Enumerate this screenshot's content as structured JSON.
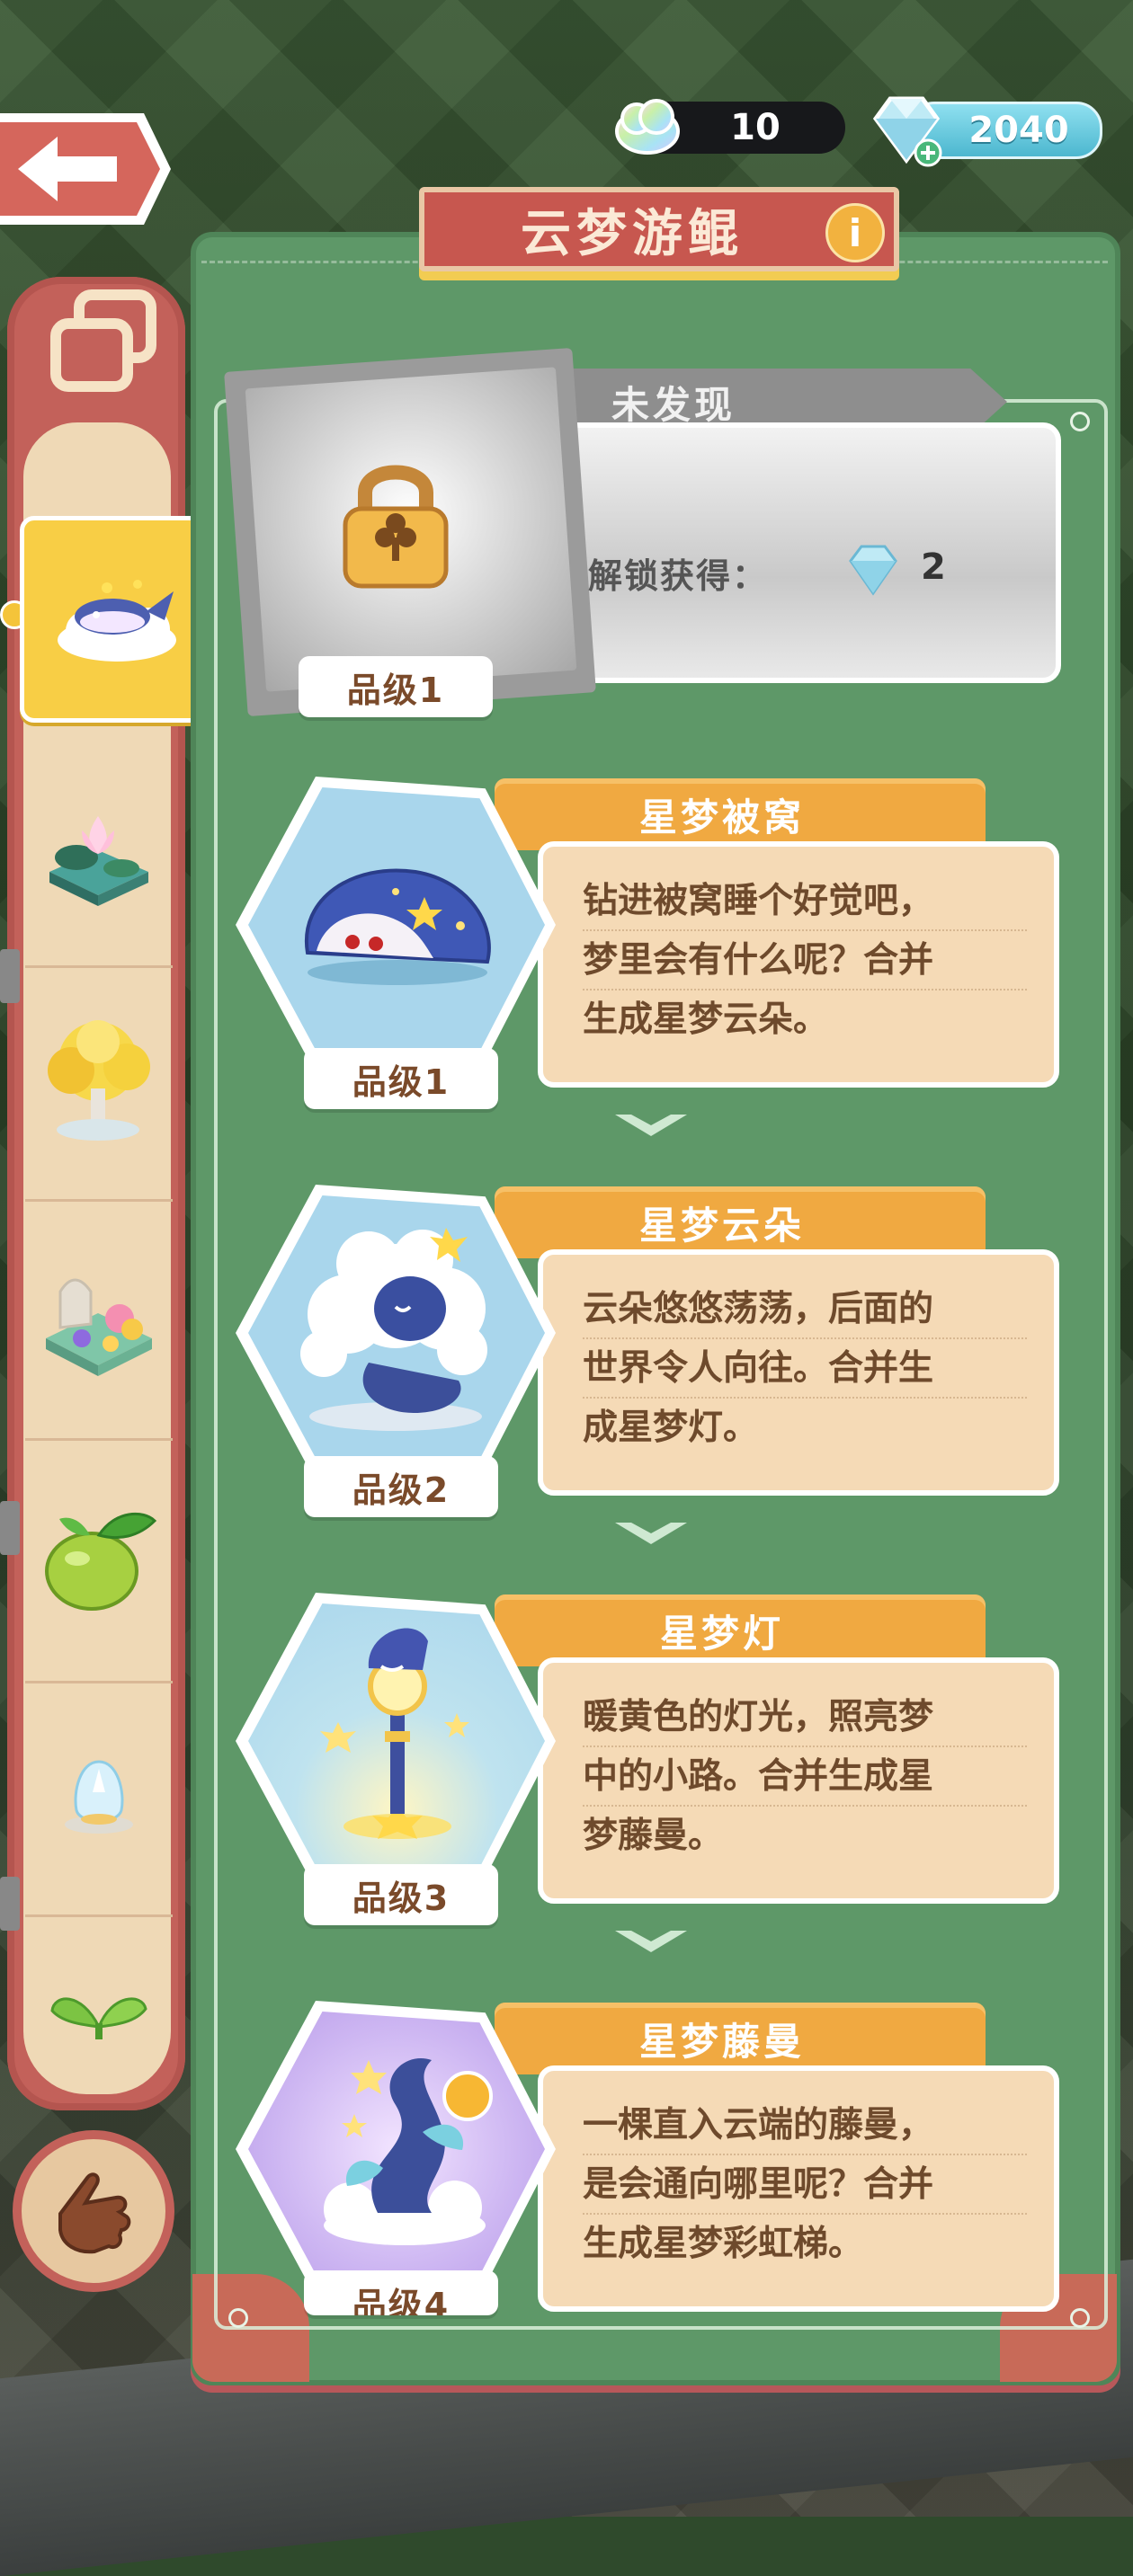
{
  "hud": {
    "cloud_count": "10",
    "gem_count": "2040"
  },
  "panel": {
    "title": "云梦游鲲",
    "info_icon_label": "i"
  },
  "locked_item": {
    "status": "未发现",
    "unlock_label": "解锁获得：",
    "reward_count": "2",
    "grade": "品级1"
  },
  "items": [
    {
      "name": "星梦被窝",
      "grade": "品级1",
      "desc": [
        "钻进被窝睡个好觉吧，",
        "梦里会有什么呢？合并",
        "生成星梦云朵。"
      ]
    },
    {
      "name": "星梦云朵",
      "grade": "品级2",
      "desc": [
        "云朵悠悠荡荡，后面的",
        "世界令人向往。合并生",
        "成星梦灯。"
      ]
    },
    {
      "name": "星梦灯",
      "grade": "品级3",
      "desc": [
        "暖黄色的灯光，照亮梦",
        "中的小路。合并生成星",
        "梦藤曼。"
      ]
    },
    {
      "name": "星梦藤曼",
      "grade": "品级4",
      "desc": [
        "一棵直入云端的藤曼，",
        "是会通向哪里呢？合并",
        "生成星梦彩虹梯。"
      ]
    }
  ],
  "sidebar": {
    "categories": [
      {
        "icon": "cloud-whale-icon",
        "active": true
      },
      {
        "icon": "lotus-pond-icon",
        "active": false
      },
      {
        "icon": "golden-tree-icon",
        "active": false
      },
      {
        "icon": "garden-building-icon",
        "active": false
      },
      {
        "icon": "lime-fruit-icon",
        "active": false
      },
      {
        "icon": "crystal-egg-icon",
        "active": false
      },
      {
        "icon": "sprout-icon",
        "active": false
      }
    ]
  },
  "colors": {
    "panel_green": "#5e9868",
    "sidebar_red": "#c3615a",
    "ribbon_orange": "#f0a941",
    "card_cream": "#f5dab6",
    "active_yellow": "#f8ce45"
  }
}
